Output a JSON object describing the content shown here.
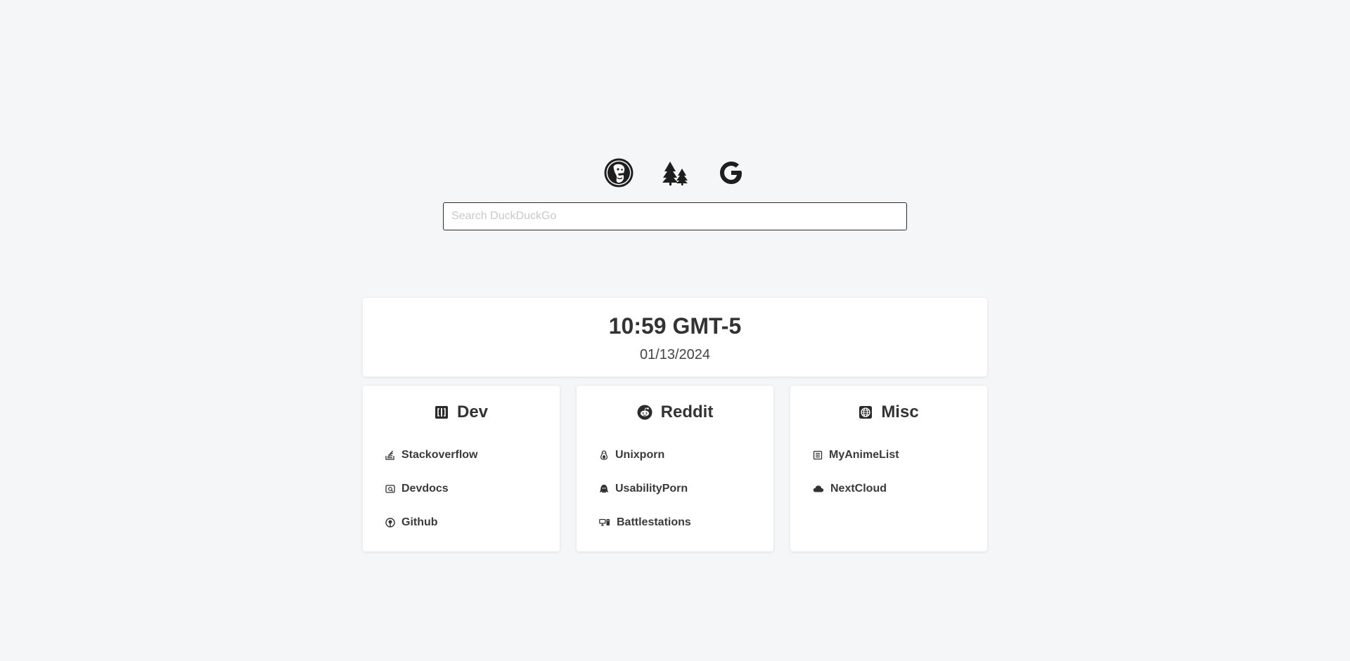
{
  "engines": [
    {
      "name": "DuckDuckGo",
      "icon": "duckduckgo-icon"
    },
    {
      "name": "Ecosia",
      "icon": "trees-icon"
    },
    {
      "name": "Google",
      "icon": "google-icon"
    }
  ],
  "search": {
    "placeholder": "Search DuckDuckGo",
    "value": ""
  },
  "clock": {
    "time": "10:59 GMT-5",
    "date": "01/13/2024"
  },
  "cards": [
    {
      "title": "Dev",
      "icon": "code-book-icon",
      "links": [
        {
          "label": "Stackoverflow",
          "icon": "stackoverflow-icon"
        },
        {
          "label": "Devdocs",
          "icon": "devdocs-icon"
        },
        {
          "label": "Github",
          "icon": "github-icon"
        }
      ]
    },
    {
      "title": "Reddit",
      "icon": "reddit-icon",
      "links": [
        {
          "label": "Unixporn",
          "icon": "linux-tux-icon"
        },
        {
          "label": "UsabilityPorn",
          "icon": "ghost-icon"
        },
        {
          "label": "Battlestations",
          "icon": "desk-setup-icon"
        }
      ]
    },
    {
      "title": "Misc",
      "icon": "globe-icon",
      "links": [
        {
          "label": "MyAnimeList",
          "icon": "list-icon"
        },
        {
          "label": "NextCloud",
          "icon": "cloud-icon"
        }
      ]
    }
  ],
  "colors": {
    "background": "#f5f6f8",
    "card": "#ffffff",
    "text": "#333333",
    "placeholder": "#c9c9c9"
  }
}
